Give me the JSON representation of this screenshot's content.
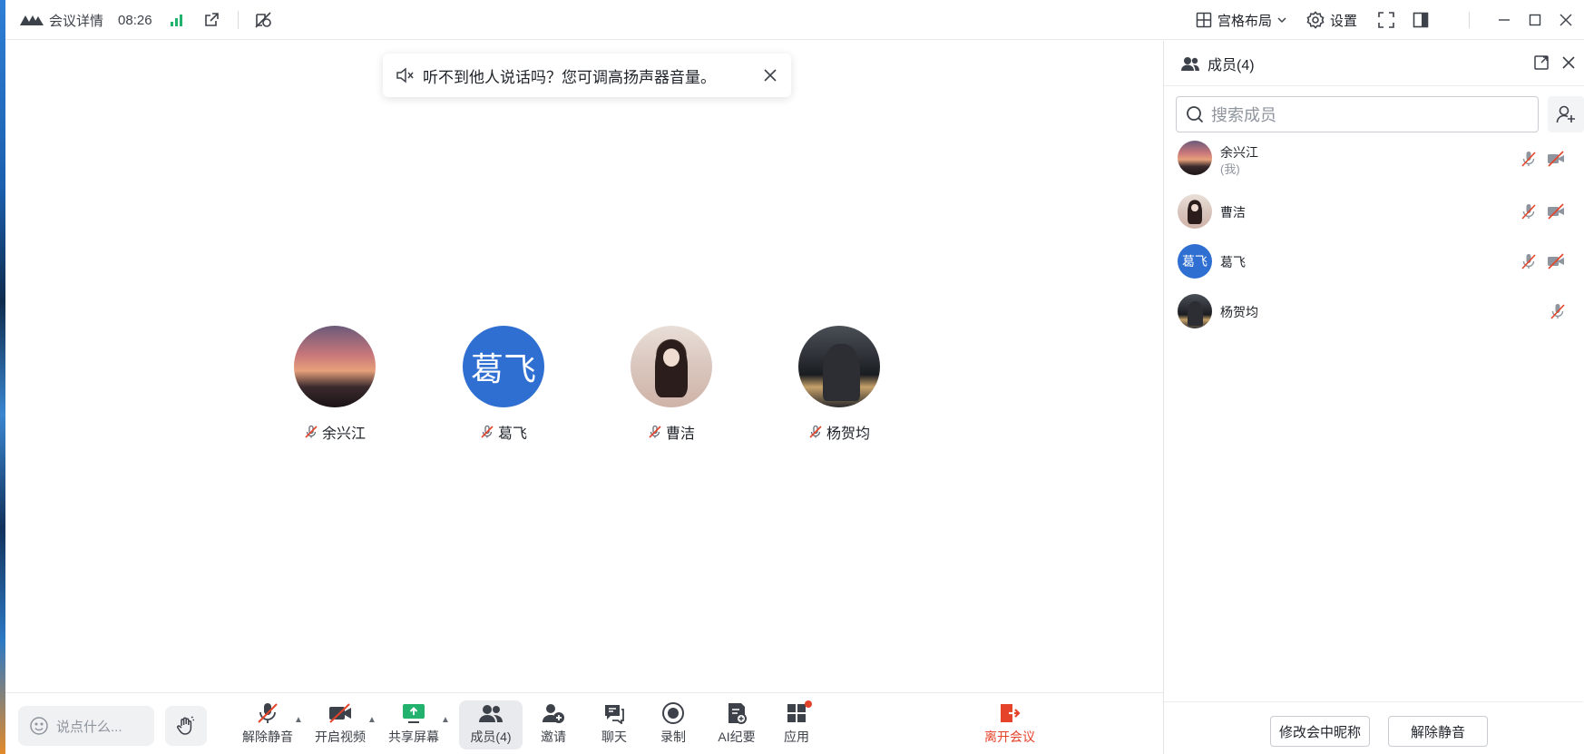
{
  "titlebar": {
    "meeting_details": "会议详情",
    "time": "08:26",
    "layout_label": "宫格布局",
    "settings_label": "设置"
  },
  "toast": {
    "message": "听不到他人说话吗？您可调高扬声器音量。"
  },
  "participants": [
    {
      "name": "余兴江",
      "avatar": "sunset-photo",
      "muted": true
    },
    {
      "name": "葛飞",
      "avatar_text": "葛飞",
      "muted": true
    },
    {
      "name": "曹洁",
      "avatar": "portrait-photo",
      "muted": true
    },
    {
      "name": "杨贺均",
      "avatar": "street-photo",
      "muted": true
    }
  ],
  "toolbar": {
    "chat_placeholder": "说点什么...",
    "unmute": "解除静音",
    "video": "开启视频",
    "share": "共享屏幕",
    "members": "成员(4)",
    "invite": "邀请",
    "chat": "聊天",
    "record": "录制",
    "ai_notes": "AI纪要",
    "apps": "应用",
    "leave": "离开会议"
  },
  "panel": {
    "title": "成员(4)",
    "search_placeholder": "搜索成员",
    "members": [
      {
        "name": "余兴江",
        "sub": "(我)"
      },
      {
        "name": "曹洁",
        "sub": ""
      },
      {
        "name": "葛飞",
        "sub": "",
        "avatar_text": "葛飞"
      },
      {
        "name": "杨贺均",
        "sub": ""
      }
    ],
    "rename_button": "修改会中昵称",
    "unmute_button": "解除静音"
  },
  "colors": {
    "accent_blue": "#2f6fd1",
    "signal_green": "#23b26d",
    "leave_red": "#e5432a",
    "muted_red": "#e5432a"
  }
}
